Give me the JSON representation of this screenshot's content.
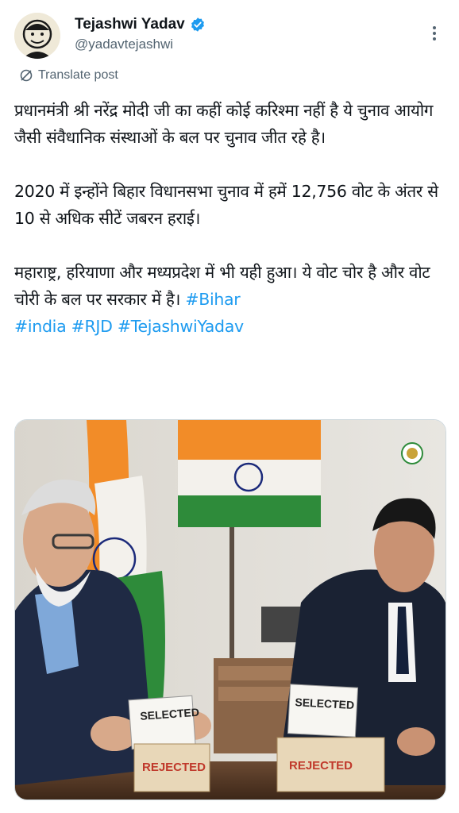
{
  "author": {
    "display_name": "Tejashwi Yadav",
    "handle": "@yadavtejashwi",
    "verified": true,
    "verified_color": "#1d9bf0"
  },
  "actions": {
    "translate_label": "Translate post",
    "more_icon": "more-vertical-icon"
  },
  "post": {
    "paragraph1": "प्रधानमंत्री श्री नरेंद्र मोदी जी का कहीं कोई करिश्मा नहीं है ये चुनाव आयोग जैसी संवैधानिक संस्थाओं के बल पर चुनाव जीत रहे है।",
    "paragraph2": "2020 में इन्होंने बिहार विधानसभा चुनाव में हमें 12,756 वोट के अंतर से 10 से अधिक सीटें जबरन हराई।",
    "paragraph3": "महाराष्ट्र, हरियाणा और मध्यप्रदेश में भी यही हुआ। ये वोट चोर है और वोट चोरी के बल पर सरकार में है।",
    "hashtags": [
      "#Bihar",
      "#india",
      "#RJD",
      "#TejashwiYadav"
    ],
    "hashtag_color": "#1d9bf0"
  },
  "media": {
    "card_left_label": "SELECTED",
    "card_right_label": "SELECTED",
    "box_left_stamp": "REJECTED",
    "box_right_stamp": "REJECTED"
  }
}
